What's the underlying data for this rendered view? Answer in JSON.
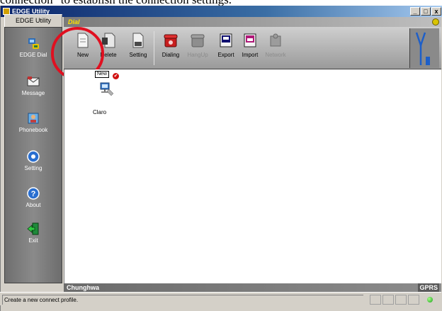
{
  "caption": "connection\" to establish the connection settings.",
  "window": {
    "title": "EDGE Utility",
    "buttons": {
      "minimize": "_",
      "maximize": "□",
      "close": "x"
    }
  },
  "sidebar": {
    "tab_label": "EDGE Utility",
    "items": [
      {
        "label": "EDGE Dial",
        "icon": "dialer-phone-icon"
      },
      {
        "label": "Message",
        "icon": "message-envelope-icon"
      },
      {
        "label": "Phonebook",
        "icon": "phonebook-contact-icon"
      },
      {
        "label": "Setting",
        "icon": "setting-gear-icon"
      },
      {
        "label": "About",
        "icon": "about-question-icon"
      },
      {
        "label": "Exit",
        "icon": "exit-door-icon"
      }
    ]
  },
  "content_header": {
    "title": "Dial"
  },
  "toolbar": {
    "buttons": [
      {
        "label": "New",
        "enabled": true
      },
      {
        "label": "Delete",
        "enabled": true
      },
      {
        "label": "Setting",
        "enabled": true
      },
      {
        "label": "Dialing",
        "enabled": true
      },
      {
        "label": "HangUp",
        "enabled": false
      },
      {
        "label": "Export",
        "enabled": true
      },
      {
        "label": "Import",
        "enabled": true
      },
      {
        "label": "Network",
        "enabled": false
      }
    ]
  },
  "profile": {
    "tag": "New",
    "name": "Claro"
  },
  "operator_bar": {
    "operator": "Chunghwa",
    "network": "GPRS"
  },
  "status": {
    "message": "Create a new connect profile."
  },
  "colors": {
    "highlight_circle": "#e01020",
    "status_led": "#1aa01a"
  }
}
